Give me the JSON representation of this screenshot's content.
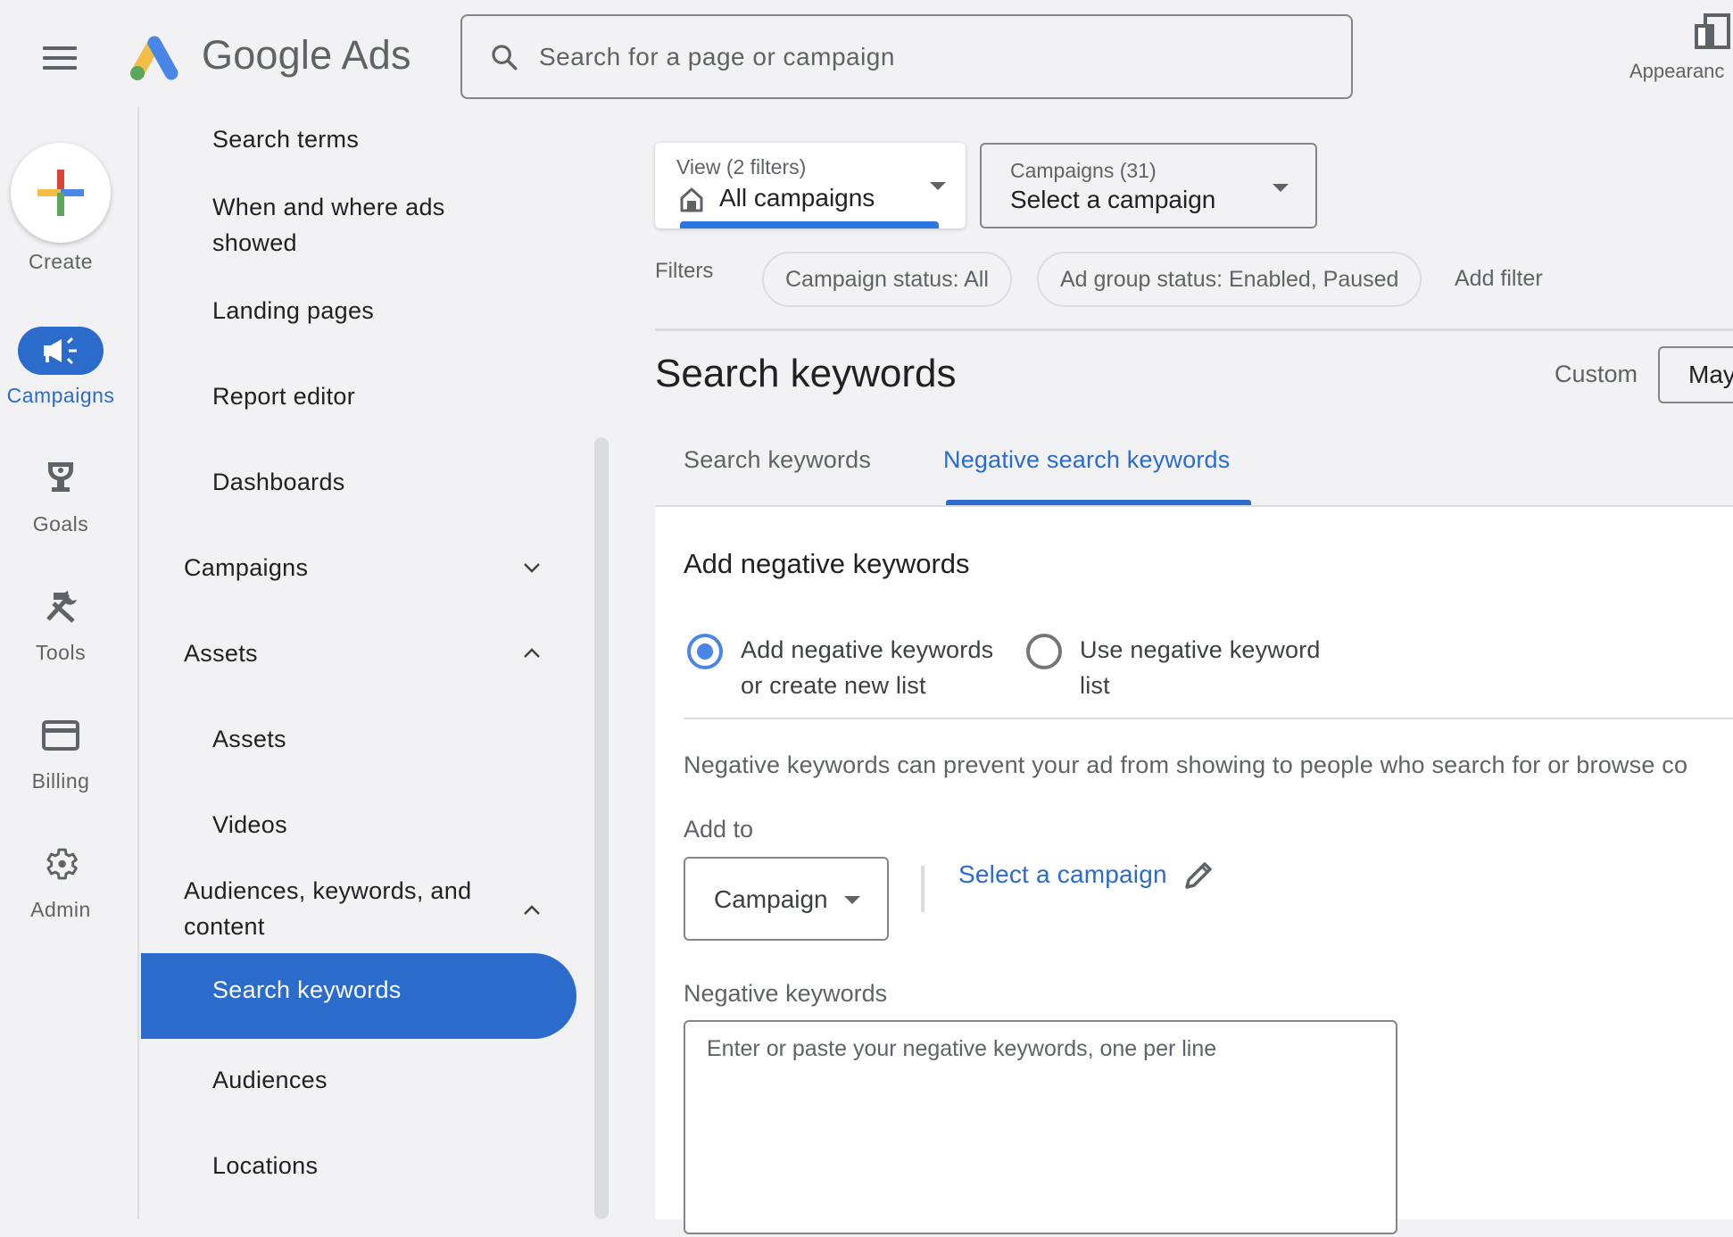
{
  "header": {
    "menu_icon": "hamburger-menu-icon",
    "brand": "Google Ads",
    "search_placeholder": "Search for a page or campaign",
    "appearance_label": "Appearanc"
  },
  "rail": {
    "create_label": "Create",
    "items": [
      {
        "label": "Campaigns",
        "icon": "megaphone-icon",
        "active": true
      },
      {
        "label": "Goals",
        "icon": "trophy-icon"
      },
      {
        "label": "Tools",
        "icon": "tools-icon"
      },
      {
        "label": "Billing",
        "icon": "credit-card-icon"
      },
      {
        "label": "Admin",
        "icon": "gear-icon"
      }
    ]
  },
  "nav": {
    "items": [
      {
        "label": "Search terms"
      },
      {
        "label": "When and where ads showed"
      },
      {
        "label": "Landing pages"
      },
      {
        "label": "Report editor"
      },
      {
        "label": "Dashboards"
      },
      {
        "label": "Campaigns",
        "expanded": false
      },
      {
        "label": "Assets",
        "expanded": true
      },
      {
        "label": "Assets"
      },
      {
        "label": "Videos"
      },
      {
        "label": "Audiences, keywords, and content",
        "expanded": true
      },
      {
        "label": "Search keywords",
        "selected": true
      },
      {
        "label": "Audiences"
      },
      {
        "label": "Locations"
      }
    ]
  },
  "toolbar": {
    "view_small": "View (2 filters)",
    "view_value": "All campaigns",
    "campaigns_small": "Campaigns (31)",
    "campaigns_value": "Select a campaign",
    "filters_label": "Filters",
    "chips": [
      "Campaign status: All",
      "Ad group status: Enabled, Paused"
    ],
    "add_filter": "Add filter"
  },
  "page": {
    "title": "Search keywords",
    "date_range_label": "Custom",
    "date_range_value": "May",
    "tabs": [
      {
        "label": "Search keywords",
        "active": false
      },
      {
        "label": "Negative search keywords",
        "active": true
      }
    ]
  },
  "form": {
    "title": "Add negative keywords",
    "radio_options": [
      {
        "line1": "Add negative keywords",
        "line2": "or create new list",
        "selected": true
      },
      {
        "line1": "Use negative keyword",
        "line2": "list",
        "selected": false
      }
    ],
    "description": "Negative keywords can prevent your ad from showing to people who search for or browse co",
    "add_to_label": "Add to",
    "add_to_value": "Campaign",
    "select_campaign_link": "Select a campaign",
    "negative_keywords_label": "Negative keywords",
    "negative_keywords_placeholder": "Enter or paste your negative keywords, one per line",
    "negative_keywords_value": ""
  },
  "colors": {
    "accent_blue": "#2b6bcc",
    "radio_blue": "#4a86e8",
    "logo_blue": "#4a86e8",
    "logo_yellow": "#f4bd45",
    "logo_green": "#5ba65b",
    "create_red": "#db4437"
  }
}
